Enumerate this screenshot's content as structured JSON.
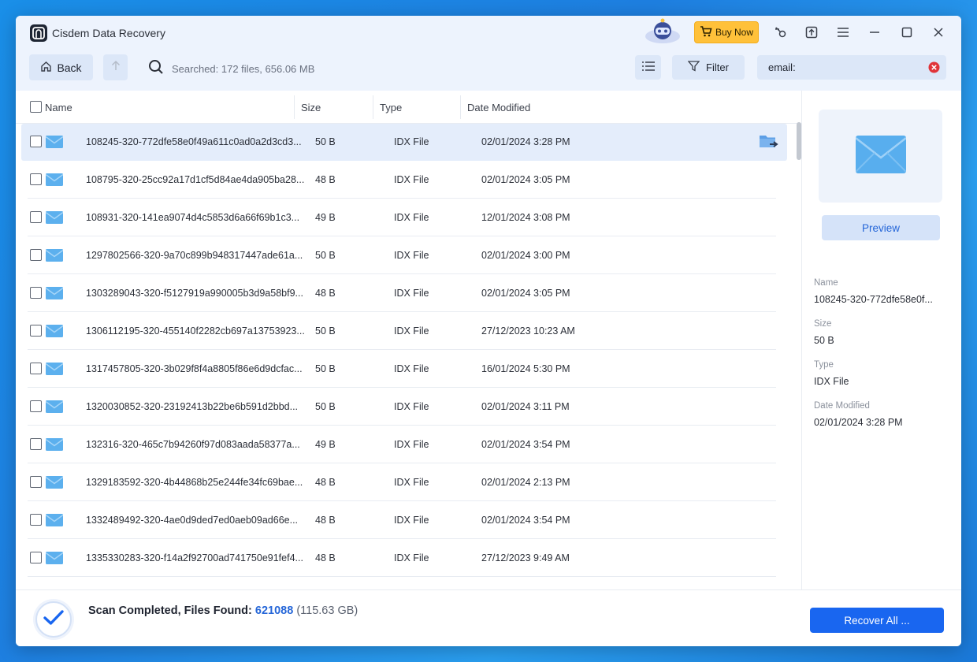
{
  "app": {
    "title": "Cisdem Data Recovery",
    "buy_label": "Buy Now"
  },
  "toolbar": {
    "back_label": "Back",
    "searched_text": "Searched: 172 files, 656.06 MB",
    "filter_label": "Filter",
    "search_value": "email:"
  },
  "table": {
    "columns": [
      "Name",
      "Size",
      "Type",
      "Date Modified"
    ],
    "rows": [
      {
        "name": "108245-320-772dfe58e0f49a611c0ad0a2d3cd3...",
        "size": "50 B",
        "type": "IDX File",
        "date": "02/01/2024 3:28 PM"
      },
      {
        "name": "108795-320-25cc92a17d1cf5d84ae4da905ba28...",
        "size": "48 B",
        "type": "IDX File",
        "date": "02/01/2024 3:05 PM"
      },
      {
        "name": "108931-320-141ea9074d4c5853d6a66f69b1c3...",
        "size": "49 B",
        "type": "IDX File",
        "date": "12/01/2024 3:08 PM"
      },
      {
        "name": "1297802566-320-9a70c899b948317447ade61a...",
        "size": "50 B",
        "type": "IDX File",
        "date": "02/01/2024 3:00 PM"
      },
      {
        "name": "1303289043-320-f5127919a990005b3d9a58bf9...",
        "size": "48 B",
        "type": "IDX File",
        "date": "02/01/2024 3:05 PM"
      },
      {
        "name": "1306112195-320-455140f2282cb697a13753923...",
        "size": "50 B",
        "type": "IDX File",
        "date": "27/12/2023 10:23 AM"
      },
      {
        "name": "1317457805-320-3b029f8f4a8805f86e6d9dcfac...",
        "size": "50 B",
        "type": "IDX File",
        "date": "16/01/2024 5:30 PM"
      },
      {
        "name": "1320030852-320-23192413b22be6b591d2bbd...",
        "size": "50 B",
        "type": "IDX File",
        "date": "02/01/2024 3:11 PM"
      },
      {
        "name": "132316-320-465c7b94260f97d083aada58377a...",
        "size": "49 B",
        "type": "IDX File",
        "date": "02/01/2024 3:54 PM"
      },
      {
        "name": "1329183592-320-4b44868b25e244fe34fc69bae...",
        "size": "48 B",
        "type": "IDX File",
        "date": "02/01/2024 2:13 PM"
      },
      {
        "name": "1332489492-320-4ae0d9ded7ed0aeb09ad66e...",
        "size": "48 B",
        "type": "IDX File",
        "date": "02/01/2024 3:54 PM"
      },
      {
        "name": "1335330283-320-f14a2f92700ad741750e91fef4...",
        "size": "48 B",
        "type": "IDX File",
        "date": "27/12/2023 9:49 AM"
      }
    ]
  },
  "sidebar": {
    "preview_label": "Preview",
    "name_label": "Name",
    "name_value": "108245-320-772dfe58e0f...",
    "size_label": "Size",
    "size_value": "50 B",
    "type_label": "Type",
    "type_value": "IDX File",
    "date_label": "Date Modified",
    "date_value": "02/01/2024 3:28 PM"
  },
  "footer": {
    "status_prefix": "Scan Completed, Files Found: ",
    "count": "621088",
    "size": "(115.63 GB)",
    "recover_label": "Recover All ..."
  },
  "colors": {
    "accent": "#1966f0",
    "topbar": "#edf3fd",
    "selected_row": "#e4edfb",
    "buy": "#ffc13a"
  },
  "icons": [
    "app-logo-icon",
    "mascot-icon",
    "cart-icon",
    "key-icon",
    "upload-icon",
    "menu-icon",
    "minimize-icon",
    "maximize-icon",
    "close-icon",
    "home-icon",
    "arrow-up-icon",
    "search-icon",
    "list-view-icon",
    "filter-icon",
    "clear-icon",
    "email-icon",
    "open-folder-icon",
    "checkmark-icon"
  ]
}
